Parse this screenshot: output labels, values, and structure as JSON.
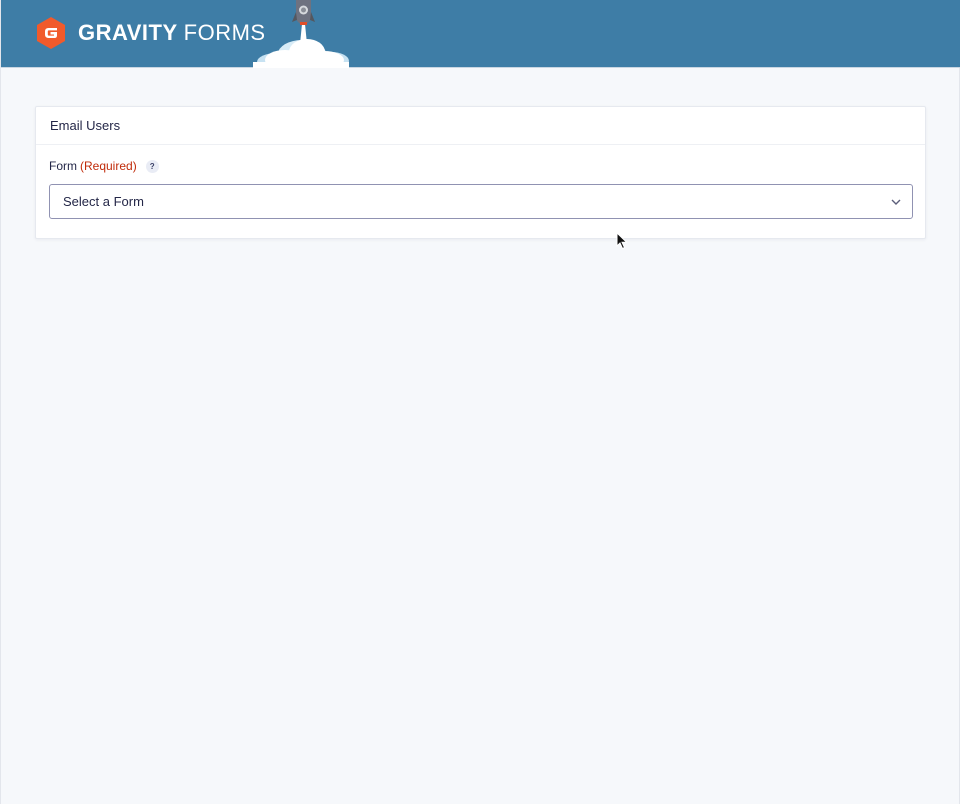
{
  "header": {
    "brand_bold": "GRAVITY",
    "brand_light": "FORMS",
    "logo_icon": "gravity-forms-logo-icon",
    "rocket_icon": "rocket-launch-icon",
    "colors": {
      "header_bg": "#3e7da6",
      "logo_orange": "#f15a2b"
    }
  },
  "card": {
    "title": "Email Users",
    "field": {
      "label": "Form",
      "required_text": "(Required)",
      "help_glyph": "?",
      "select_value": "Select a Form"
    }
  },
  "colors": {
    "required": "#c02b0a",
    "page_bg": "#f6f8fb"
  }
}
